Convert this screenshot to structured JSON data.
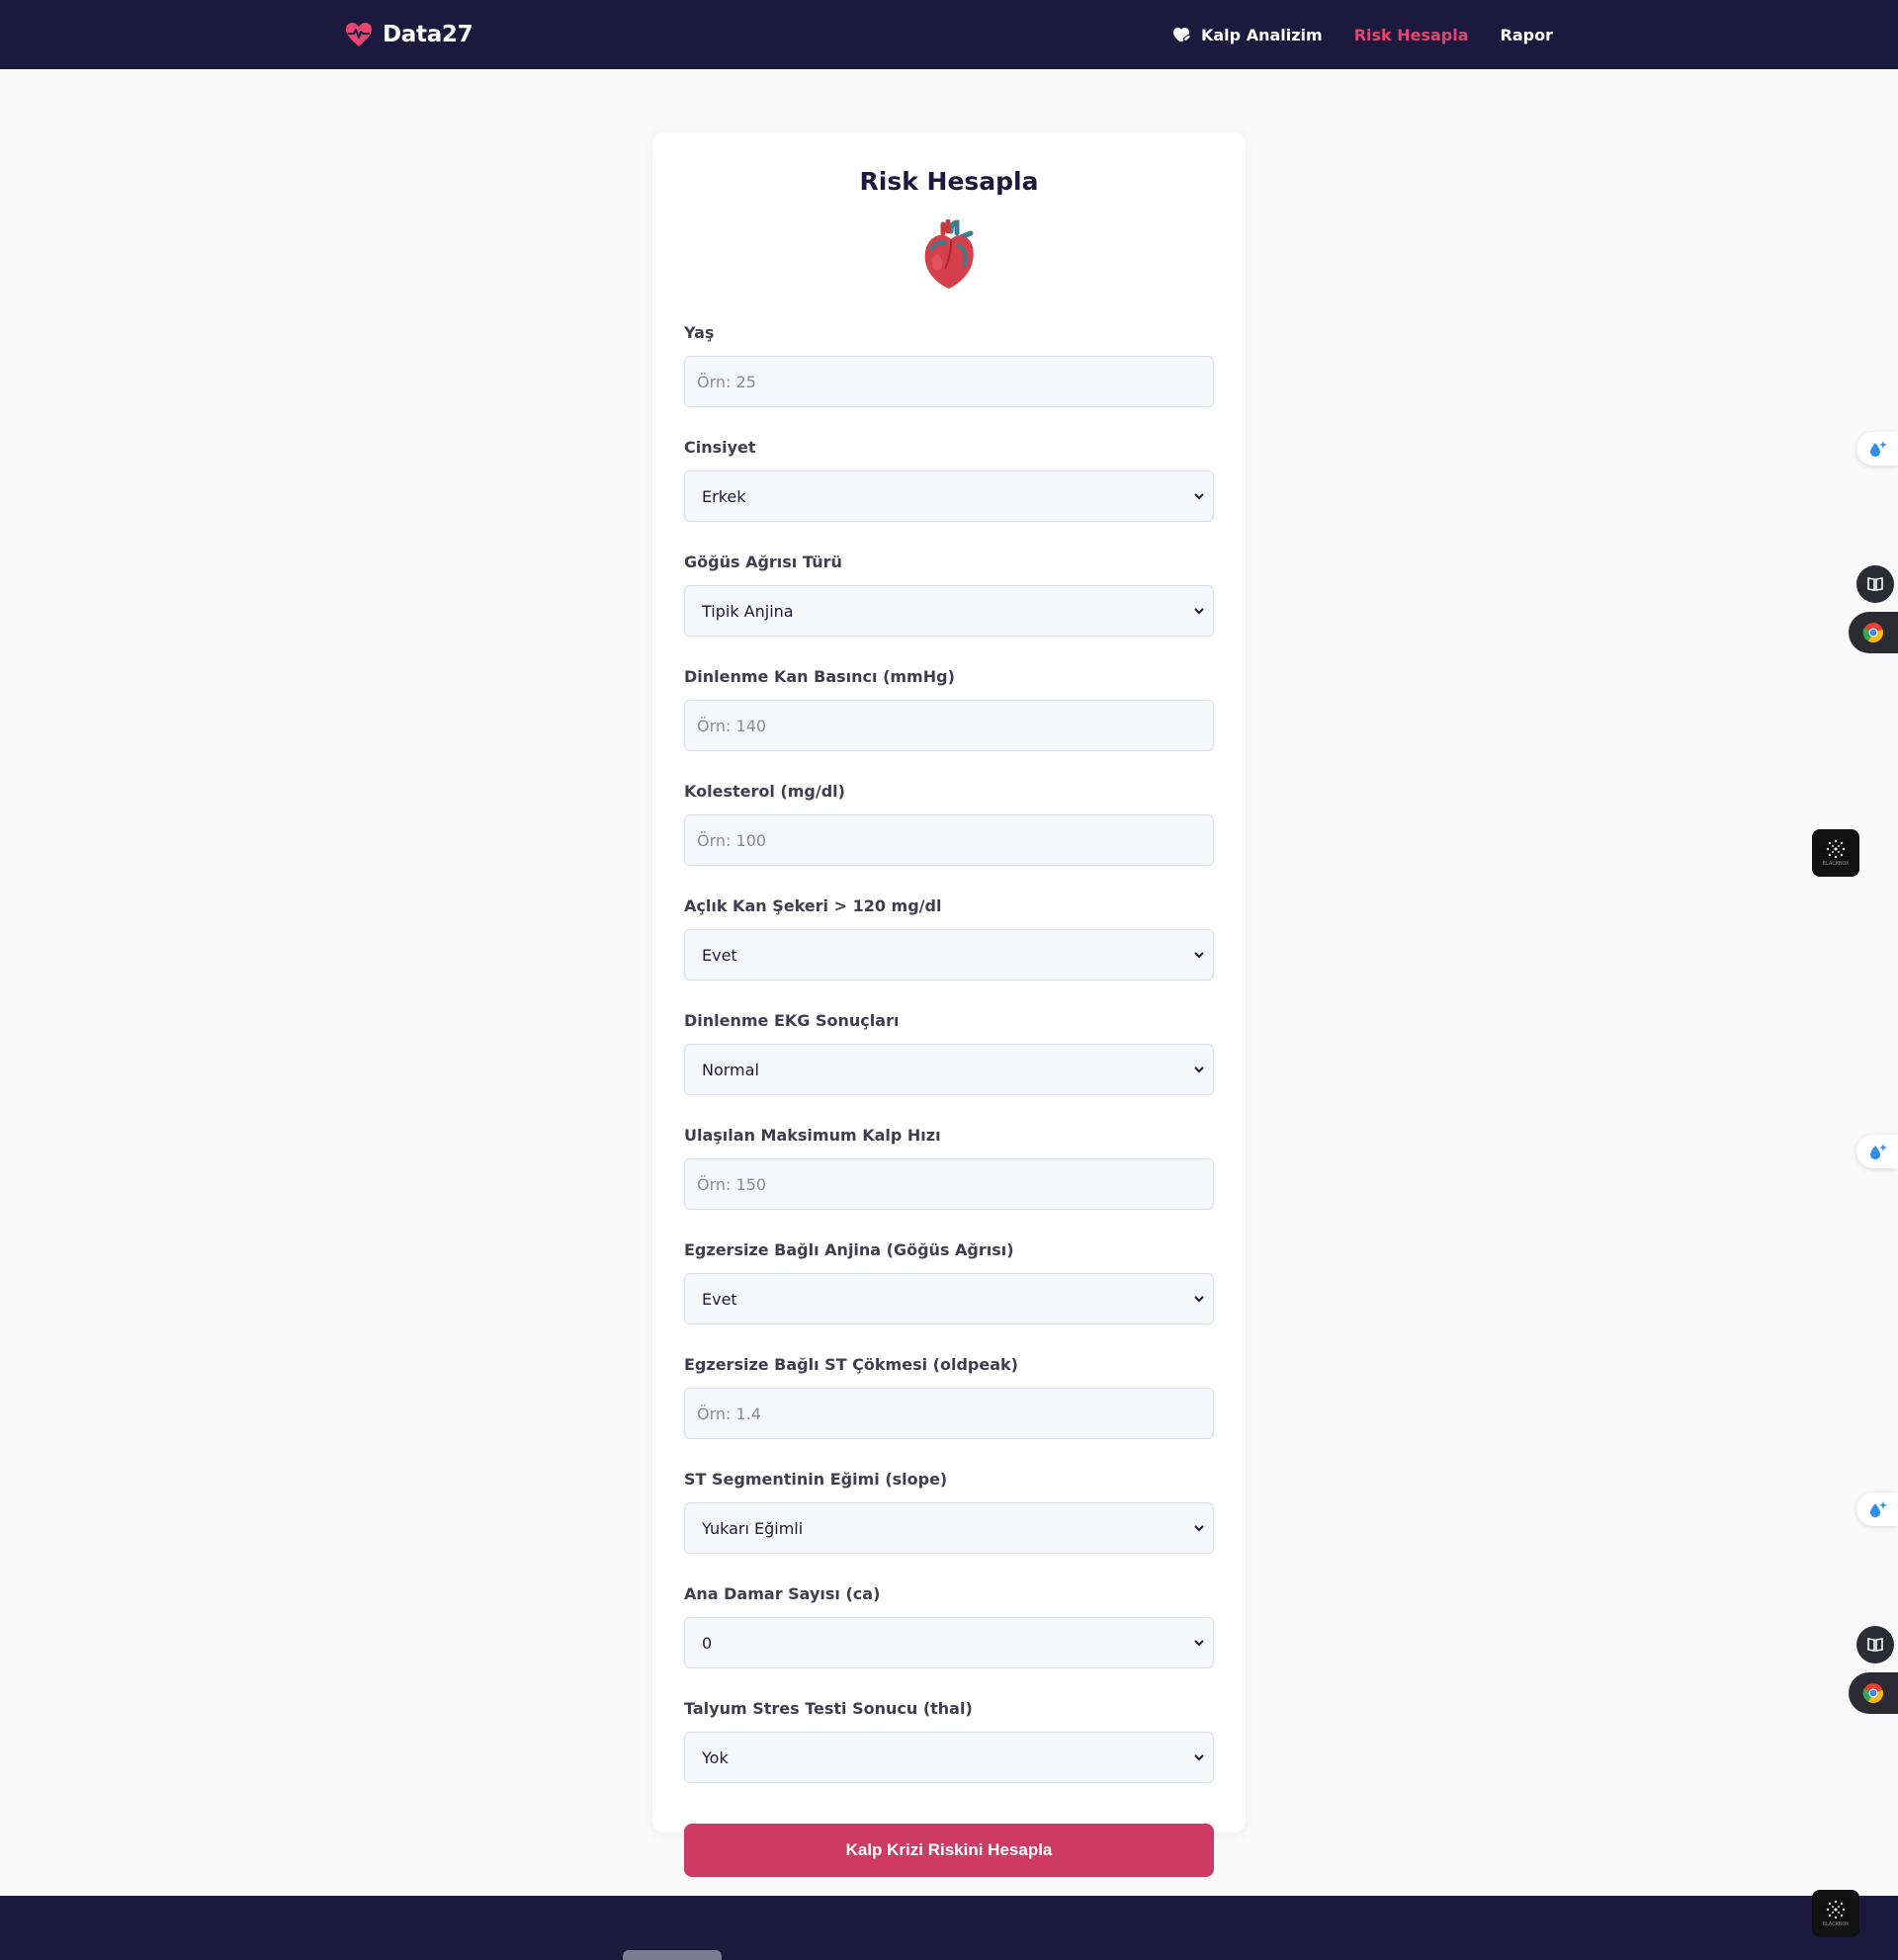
{
  "header": {
    "brand": "Data27",
    "nav": [
      {
        "label": "Kalp Analizim",
        "active": false
      },
      {
        "label": "Risk Hesapla",
        "active": true
      },
      {
        "label": "Rapor",
        "active": false
      }
    ]
  },
  "form": {
    "title": "Risk Hesapla",
    "fields": {
      "age": {
        "label": "Yaş",
        "placeholder": "Örn: 25"
      },
      "sex": {
        "label": "Cinsiyet",
        "value": "Erkek"
      },
      "cp": {
        "label": "Göğüs Ağrısı Türü",
        "value": "Tipik Anjina"
      },
      "trestbps": {
        "label": "Dinlenme Kan Basıncı (mmHg)",
        "placeholder": "Örn: 140"
      },
      "chol": {
        "label": "Kolesterol (mg/dl)",
        "placeholder": "Örn: 100"
      },
      "fbs": {
        "label": "Açlık Kan Şekeri > 120 mg/dl",
        "value": "Evet"
      },
      "restecg": {
        "label": "Dinlenme EKG Sonuçları",
        "value": "Normal"
      },
      "thalach": {
        "label": "Ulaşılan Maksimum Kalp Hızı",
        "placeholder": "Örn: 150"
      },
      "exang": {
        "label": "Egzersize Bağlı Anjina (Göğüs Ağrısı)",
        "value": "Evet"
      },
      "oldpeak": {
        "label": "Egzersize Bağlı ST Çökmesi (oldpeak)",
        "placeholder": "Örn: 1.4"
      },
      "slope": {
        "label": "ST Segmentinin Eğimi (slope)",
        "value": "Yukarı Eğimli"
      },
      "ca": {
        "label": "Ana Damar Sayısı (ca)",
        "value": "0"
      },
      "thal": {
        "label": "Talyum Stres Testi Sonucu (thal)",
        "value": "Yok"
      }
    },
    "submit_label": "Kalp Krizi Riskini Hesapla"
  },
  "widgets": {
    "blackbox_label": "BLACKBOX"
  },
  "colors": {
    "navbar": "#1b1a3e",
    "accent": "#e6456f",
    "button": "#cf3a62",
    "card": "#ffffff"
  },
  "icons": [
    "heart-pulse-icon",
    "heart-hand-icon",
    "anatomical-heart-icon",
    "chevron-down-icon",
    "sparkle-drop-icon",
    "book-icon",
    "chrome-icon",
    "blackbox-icon"
  ]
}
